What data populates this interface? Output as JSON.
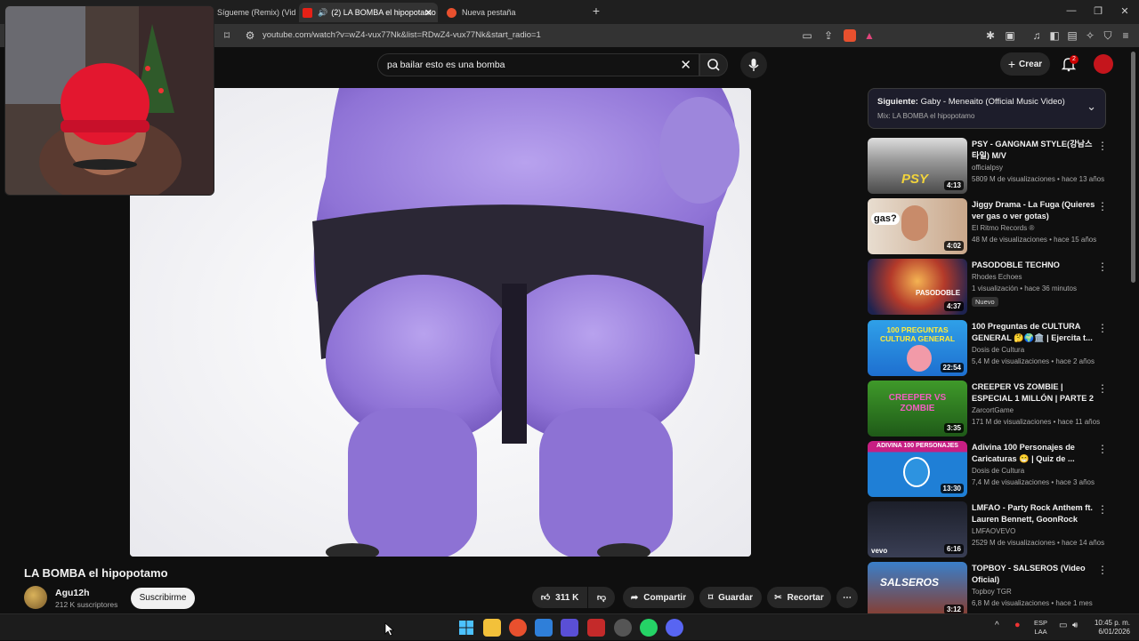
{
  "browser": {
    "tabs": [
      {
        "label": "Sígueme (Remix) (Vid",
        "active": false
      },
      {
        "label": "(2) LA BOMBA el hipopotamo",
        "active": true
      },
      {
        "label": "Nueva pestaña",
        "active": false
      }
    ],
    "url": "youtube.com/watch?v=wZ4-vux77Nk&list=RDwZ4-vux77Nk&start_radio=1"
  },
  "youtube": {
    "search_query": "pa bailar esto es una bomba",
    "create_label": "Crear",
    "notification_count": "2",
    "video": {
      "title": "LA BOMBA el hipopotamo",
      "channel": "Agu12h",
      "subscribers": "212 K suscriptores",
      "subscribe_label": "Suscribirme",
      "likes": "311 K",
      "share_label": "Compartir",
      "save_label": "Guardar",
      "clip_label": "Recortar"
    },
    "up_next": {
      "label": "Siguiente:",
      "title": "Gaby - Meneaito (Official Music Video)",
      "mix": "Mix: LA BOMBA el hipopotamo"
    },
    "recommendations": [
      {
        "title": "PSY - GANGNAM STYLE(강남스타일) M/V",
        "channel": "officialpsy",
        "meta": "5809 M de visualizaciones • hace 13 años",
        "duration": "4:13",
        "badge": ""
      },
      {
        "title": "Jiggy Drama - La Fuga (Quieres ver gas o ver gotas)",
        "channel": "El Ritmo Records ®",
        "meta": "48 M de visualizaciones • hace 15 años",
        "duration": "4:02",
        "badge": ""
      },
      {
        "title": "PASODOBLE TECHNO",
        "channel": "Rhodes Echoes",
        "meta": "1 visualización • hace 36 minutos",
        "duration": "4:37",
        "badge": "Nuevo"
      },
      {
        "title": "100 Preguntas de CULTURA GENERAL 🤔🌍🏛️ | Ejercita t...",
        "channel": "Dosis de Cultura",
        "meta": "5,4 M de visualizaciones • hace 2 años",
        "duration": "22:54",
        "badge": ""
      },
      {
        "title": "CREEPER VS ZOMBIE | ESPECIAL 1 MILLÓN | PARTE 2",
        "channel": "ZarcortGame",
        "meta": "171 M de visualizaciones • hace 11 años",
        "duration": "3:35",
        "badge": ""
      },
      {
        "title": "Adivina 100 Personajes de Caricaturas 😁 | Quiz de ...",
        "channel": "Dosis de Cultura",
        "meta": "7,4 M de visualizaciones • hace 3 años",
        "duration": "13:30",
        "badge": ""
      },
      {
        "title": "LMFAO - Party Rock Anthem ft. Lauren Bennett, GoonRock",
        "channel": "LMFAOVEVO",
        "meta": "2529 M de visualizaciones • hace 14 años",
        "duration": "6:16",
        "badge": ""
      },
      {
        "title": "TOPBOY - SALSEROS (Video Oficial) #BULLSHITDELACALL...",
        "channel": "Topboy TGR",
        "meta": "6,8 M de visualizaciones • hace 1 mes",
        "duration": "3:12",
        "badge": ""
      }
    ],
    "thumb_texts": [
      "PSY",
      "gas?",
      "PASODOBLE",
      "100 PREGUNTAS CULTURA GENERAL",
      "CREEPER VS ZOMBIE",
      "ADIVINA 100 PERSONAJES",
      "vevo",
      "SALSEROS"
    ]
  },
  "taskbar": {
    "lang_line1": "ESP",
    "lang_line2": "LAA",
    "time": "10:45 p. m.",
    "date": "6/01/2026"
  }
}
